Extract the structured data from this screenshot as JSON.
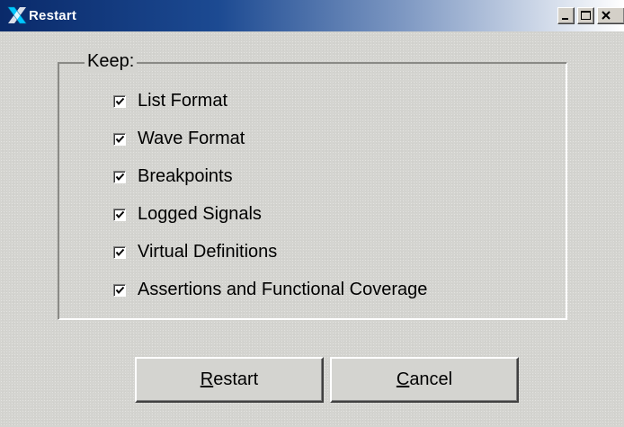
{
  "window": {
    "title": "Restart",
    "controls": {
      "minimize_icon": "minimize-icon",
      "maximize_icon": "maximize-icon",
      "close_icon": "close-icon"
    }
  },
  "group": {
    "legend": "Keep:",
    "options": [
      {
        "label": "List Format",
        "checked": true
      },
      {
        "label": "Wave Format",
        "checked": true
      },
      {
        "label": "Breakpoints",
        "checked": true
      },
      {
        "label": "Logged Signals",
        "checked": true
      },
      {
        "label": "Virtual Definitions",
        "checked": true
      },
      {
        "label": "Assertions and Functional Coverage",
        "checked": true
      }
    ]
  },
  "buttons": {
    "restart": {
      "mnemonic": "R",
      "rest": "estart"
    },
    "cancel": {
      "mnemonic": "C",
      "rest": "ancel"
    }
  },
  "colors": {
    "titlebar_start": "#0a2a6a",
    "titlebar_end": "#ffffff",
    "dialog_bg": "#d4d4d0",
    "icon_accent": "#00c8ff"
  }
}
